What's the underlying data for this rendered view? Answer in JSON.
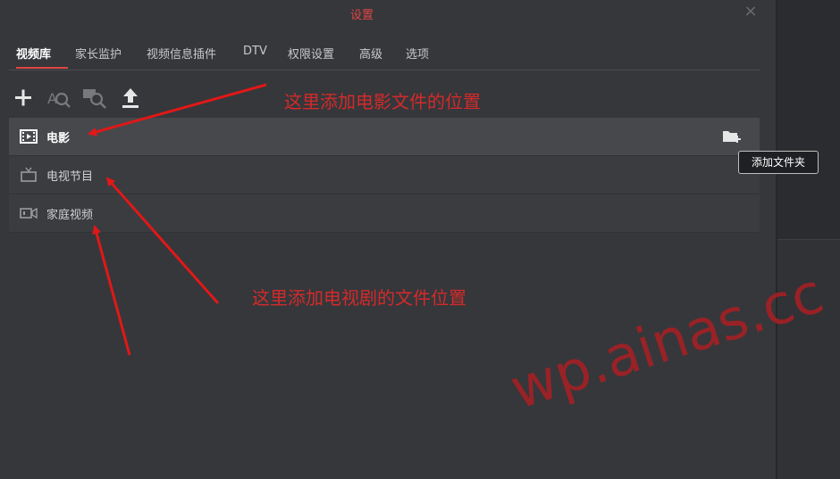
{
  "window": {
    "title": "设置",
    "close_symbol": "×"
  },
  "tabs": [
    {
      "label": "视频库",
      "active": true
    },
    {
      "label": "家长监护",
      "active": false
    },
    {
      "label": "视频信息插件",
      "active": false
    },
    {
      "label": "DTV",
      "active": false
    },
    {
      "label": "权限设置",
      "active": false
    },
    {
      "label": "高级",
      "active": false
    },
    {
      "label": "选项",
      "active": false
    }
  ],
  "toolbar": {
    "icons": [
      "add-icon",
      "search-scan-icon",
      "search-media-icon",
      "upload-icon"
    ]
  },
  "library": {
    "items": [
      {
        "label": "电影",
        "icon": "film-icon",
        "selected": true
      },
      {
        "label": "电视节目",
        "icon": "tv-icon",
        "selected": false
      },
      {
        "label": "家庭视频",
        "icon": "video-camera-icon",
        "selected": false
      }
    ],
    "add_folder_icon": "add-folder-icon",
    "tooltip": "添加文件夹"
  },
  "annotations": {
    "movie_note": "这里添加电影文件的位置",
    "tv_note": "这里添加电视剧的文件位置"
  },
  "watermark": "wp.ainas.cc",
  "colors": {
    "accent": "#e04545",
    "annotation": "#d42a2a",
    "dialog_bg": "#35373b"
  }
}
